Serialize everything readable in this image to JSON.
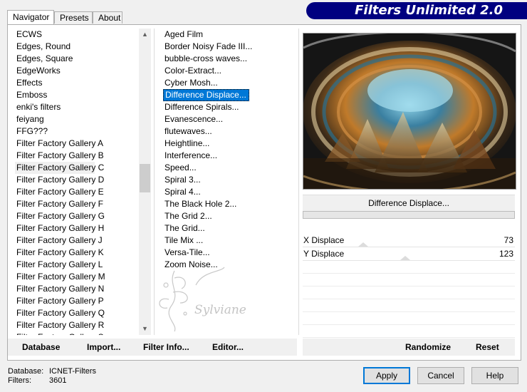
{
  "tabs": [
    {
      "label": "Navigator",
      "active": true
    },
    {
      "label": "Presets",
      "active": false
    },
    {
      "label": "About",
      "active": false
    }
  ],
  "banner": {
    "title": "Filters Unlimited 2.0",
    "color": "#000080"
  },
  "categories": {
    "items": [
      "ECWS",
      "Edges, Round",
      "Edges, Square",
      "EdgeWorks",
      "Effects",
      "Emboss",
      "enki's filters",
      "feiyang",
      "FFG???",
      "Filter Factory Gallery A",
      "Filter Factory Gallery B",
      "Filter Factory Gallery C",
      "Filter Factory Gallery D",
      "Filter Factory Gallery E",
      "Filter Factory Gallery F",
      "Filter Factory Gallery G",
      "Filter Factory Gallery H",
      "Filter Factory Gallery J",
      "Filter Factory Gallery K",
      "Filter Factory Gallery L",
      "Filter Factory Gallery M",
      "Filter Factory Gallery N",
      "Filter Factory Gallery P",
      "Filter Factory Gallery Q",
      "Filter Factory Gallery R",
      "Filter Factory Gallery S"
    ],
    "selected": "Filter Factory Gallery C"
  },
  "filters": {
    "items": [
      "Aged Film",
      "Border Noisy Fade III...",
      "bubble-cross waves...",
      "Color-Extract...",
      "Cyber Mosh...",
      "Difference Displace...",
      "Difference Spirals...",
      "Evanescence...",
      "flutewaves...",
      "Heightline...",
      "Interference...",
      "Speed...",
      "Spiral 3...",
      "Spiral 4...",
      "The Black Hole 2...",
      "The Grid 2...",
      "The Grid...",
      "Tile Mix ...",
      "Versa-Tile...",
      "Zoom Noise..."
    ],
    "selected": "Difference Displace..."
  },
  "selected_filter_label": "Difference Displace...",
  "params": [
    {
      "label": "X Displace",
      "value": "73",
      "fraction": 0.286
    },
    {
      "label": "Y Displace",
      "value": "123",
      "fraction": 0.482
    }
  ],
  "left_buttons": {
    "database": "Database",
    "import": "Import...",
    "filter_info": "Filter Info...",
    "editor": "Editor..."
  },
  "right_buttons": {
    "randomize": "Randomize",
    "reset": "Reset"
  },
  "status": {
    "database_label": "Database:",
    "database_value": "ICNET-Filters",
    "filters_label": "Filters:",
    "filters_value": "3601"
  },
  "dialog_buttons": {
    "apply": "Apply",
    "cancel": "Cancel",
    "help": "Help"
  },
  "watermark_text": "Sylviane",
  "colors": {
    "selection": "#0078d7",
    "default_button_border": "#0078d7"
  }
}
